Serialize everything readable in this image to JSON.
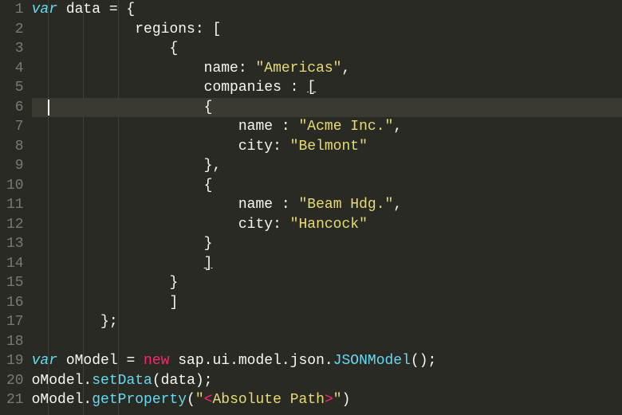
{
  "lineNumbers": [
    "1",
    "2",
    "3",
    "4",
    "5",
    "6",
    "7",
    "8",
    "9",
    "10",
    "11",
    "12",
    "13",
    "14",
    "15",
    "16",
    "17",
    "18",
    "19",
    "20",
    "21"
  ],
  "code": {
    "l1": {
      "kw": "var",
      "ident": " data",
      "punct": " = {"
    },
    "l2": {
      "text": "            regions: ["
    },
    "l3": {
      "text": "                {"
    },
    "l4": {
      "indent": "                    ",
      "prop": "name: ",
      "str": "\"Americas\"",
      "end": ","
    },
    "l5": {
      "indent": "                    ",
      "prop": "companies : ",
      "bracket": "["
    },
    "l6": {
      "indent": "                    ",
      "brace": "{"
    },
    "l7": {
      "indent": "                        ",
      "prop": "name : ",
      "str": "\"Acme Inc.\"",
      "end": ","
    },
    "l8": {
      "indent": "                        ",
      "prop": "city: ",
      "str": "\"Belmont\""
    },
    "l9": {
      "indent": "                    ",
      "brace": "},"
    },
    "l10": {
      "indent": "                    ",
      "brace": "{"
    },
    "l11": {
      "indent": "                        ",
      "prop": "name : ",
      "str": "\"Beam Hdg.\"",
      "end": ","
    },
    "l12": {
      "indent": "                        ",
      "prop": "city: ",
      "str": "\"Hancock\""
    },
    "l13": {
      "indent": "                    ",
      "brace": "}"
    },
    "l14": {
      "indent": "                    ",
      "bracket": "]"
    },
    "l15": {
      "indent": "                ",
      "brace": "}"
    },
    "l16": {
      "indent": "                ",
      "bracket": "]"
    },
    "l17": {
      "indent": "        ",
      "end": "};"
    },
    "l18": {
      "text": ""
    },
    "l19": {
      "kw": "var",
      "ident": " oModel",
      "eq": " = ",
      "new": "new",
      "call": " sap.ui.model.json.",
      "ctor": "JSONModel",
      "paren": "();"
    },
    "l20": {
      "obj": "oModel.",
      "method": "setData",
      "args": "(data);"
    },
    "l21": {
      "obj": "oModel.",
      "method": "getProperty",
      "open": "(",
      "q1": "\"",
      "lt": "<",
      "pathtext": "Absolute Path",
      "gt": ">",
      "q2": "\"",
      "close": ")"
    }
  },
  "currentLine": 6
}
